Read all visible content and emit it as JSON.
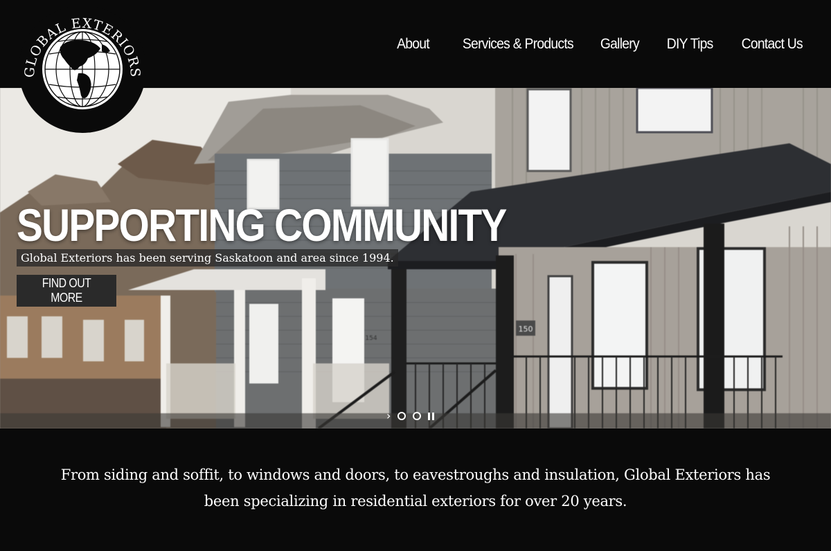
{
  "logo": {
    "text": "GLOBAL EXTERIORS",
    "icon": "globe-icon"
  },
  "nav": {
    "items": [
      {
        "label": "About"
      },
      {
        "label": "Services & Products"
      },
      {
        "label": "Gallery"
      },
      {
        "label": "DIY Tips"
      },
      {
        "label": "Contact Us"
      }
    ]
  },
  "hero": {
    "title": "SUPPORTING COMMUNITY",
    "subtitle": "Global Exteriors has been serving Saskatoon and area since 1994.",
    "button_label": "FIND OUT MORE",
    "house_numbers": [
      "154",
      "150"
    ],
    "slider": {
      "next_icon": "chevron-right-icon",
      "slide_count": 2,
      "pause_icon": "pause-icon"
    }
  },
  "intro": {
    "text": "From siding and soffit, to windows and doors, to eavestroughs and insulation, Global Exteriors has been specializing in residential exteriors for over 20 years."
  },
  "colors": {
    "header_bg": "#0a0a0a",
    "text": "#ffffff",
    "button_bg": "#2a2a2a"
  }
}
